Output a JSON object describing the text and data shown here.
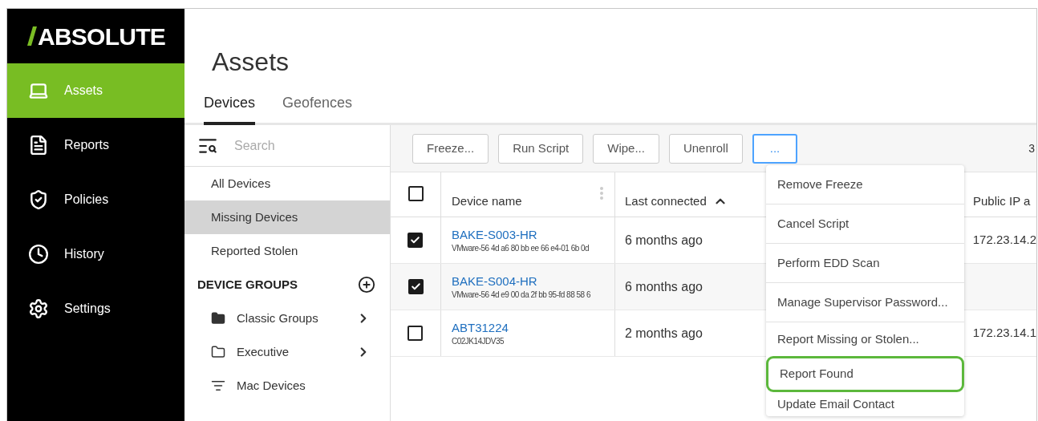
{
  "logo": {
    "text": "ABSOLUTE"
  },
  "nav": [
    {
      "label": "Assets",
      "selected": true
    },
    {
      "label": "Reports",
      "selected": false
    },
    {
      "label": "Policies",
      "selected": false
    },
    {
      "label": "History",
      "selected": false
    },
    {
      "label": "Settings",
      "selected": false
    }
  ],
  "page_title": "Assets",
  "tabs": [
    {
      "label": "Devices",
      "selected": true
    },
    {
      "label": "Geofences",
      "selected": false
    }
  ],
  "search": {
    "placeholder": "Search"
  },
  "filters": [
    {
      "label": "All Devices",
      "selected": false
    },
    {
      "label": "Missing Devices",
      "selected": true
    },
    {
      "label": "Reported Stolen",
      "selected": false
    }
  ],
  "device_groups": {
    "title": "DEVICE GROUPS",
    "items": [
      {
        "label": "Classic Groups",
        "expandable": true
      },
      {
        "label": "Executive",
        "expandable": true
      },
      {
        "label": "Mac Devices",
        "expandable": false
      }
    ]
  },
  "toolbar": {
    "buttons": [
      {
        "label": "Freeze...",
        "active": false
      },
      {
        "label": "Run Script",
        "active": false
      },
      {
        "label": "Wipe...",
        "active": false
      },
      {
        "label": "Unenroll",
        "active": false
      },
      {
        "label": "...",
        "active": true
      }
    ],
    "count": "3"
  },
  "table": {
    "columns": [
      "Device name",
      "Last connected",
      "Public IP a"
    ],
    "header_checked": false,
    "rows": [
      {
        "checked": true,
        "name": "BAKE-S003-HR",
        "serial": "VMware-56 4d a6 80 bb ee 66 e4-01 6b 0d",
        "last_connected": "6 months ago",
        "ip": "172.23.14.2"
      },
      {
        "checked": true,
        "name": "BAKE-S004-HR",
        "serial": "VMware-56 4d e9 00 da 2f bb 95-fd 88 58 6",
        "last_connected": "6 months ago"
      },
      {
        "checked": false,
        "name": "ABT31224",
        "serial": "C02JK14JDV35",
        "last_connected": "2 months ago",
        "ip": "172.23.14.1"
      }
    ]
  },
  "menu": [
    {
      "label": "Remove Freeze",
      "highlighted": false
    },
    {
      "label": "Cancel Script",
      "highlighted": false
    },
    {
      "label": "Perform EDD Scan",
      "highlighted": false
    },
    {
      "label": "Manage Supervisor Password...",
      "highlighted": false
    },
    {
      "label": "Report Missing or Stolen...",
      "highlighted": false
    },
    {
      "label": "Report Found",
      "highlighted": true
    },
    {
      "label": "Update Email Contact",
      "highlighted": false
    }
  ]
}
